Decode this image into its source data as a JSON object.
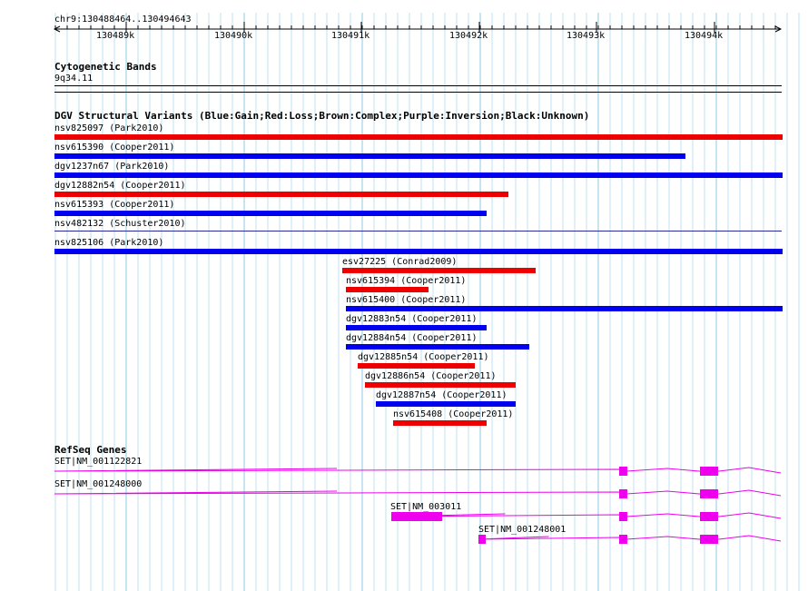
{
  "ruler": {
    "position": "chr9:130488464..130494643",
    "ticks": [
      "130489k",
      "130490k",
      "130491k",
      "130492k",
      "130493k",
      "130494k"
    ]
  },
  "cytoband": {
    "title": "Cytogenetic Bands",
    "band": "9q34.11"
  },
  "dgv": {
    "title": "DGV Structural Variants (Blue:Gain;Red:Loss;Brown:Complex;Purple:Inversion;Black:Unknown)",
    "colors": {
      "gain": "#0000ee",
      "loss": "#ee0000"
    },
    "variants": [
      {
        "label": "nsv825097 (Park2010)",
        "type": "loss"
      },
      {
        "label": "nsv615390 (Cooper2011)",
        "type": "gain"
      },
      {
        "label": "dgv1237n67 (Park2010)",
        "type": "gain"
      },
      {
        "label": "dgv12882n54 (Cooper2011)",
        "type": "loss"
      },
      {
        "label": "nsv615393 (Cooper2011)",
        "type": "gain"
      },
      {
        "label": "nsv482132 (Schuster2010)",
        "type": "gain"
      },
      {
        "label": "nsv825106 (Park2010)",
        "type": "gain"
      },
      {
        "label": "esv27225 (Conrad2009)",
        "type": "loss"
      },
      {
        "label": "nsv615394 (Cooper2011)",
        "type": "loss"
      },
      {
        "label": "nsv615400 (Cooper2011)",
        "type": "gain"
      },
      {
        "label": "dgv12883n54 (Cooper2011)",
        "type": "gain"
      },
      {
        "label": "dgv12884n54 (Cooper2011)",
        "type": "gain"
      },
      {
        "label": "dgv12885n54 (Cooper2011)",
        "type": "loss"
      },
      {
        "label": "dgv12886n54 (Cooper2011)",
        "type": "loss"
      },
      {
        "label": "dgv12887n54 (Cooper2011)",
        "type": "gain"
      },
      {
        "label": "nsv615408 (Cooper2011)",
        "type": "loss"
      }
    ]
  },
  "refseq": {
    "title": "RefSeq Genes",
    "color": "#ee00ee",
    "genes": [
      {
        "label": "SET|NM_001122821"
      },
      {
        "label": "SET|NM_001248000"
      },
      {
        "label": "SET|NM_003011"
      },
      {
        "label": "SET|NM_001248001"
      }
    ]
  }
}
